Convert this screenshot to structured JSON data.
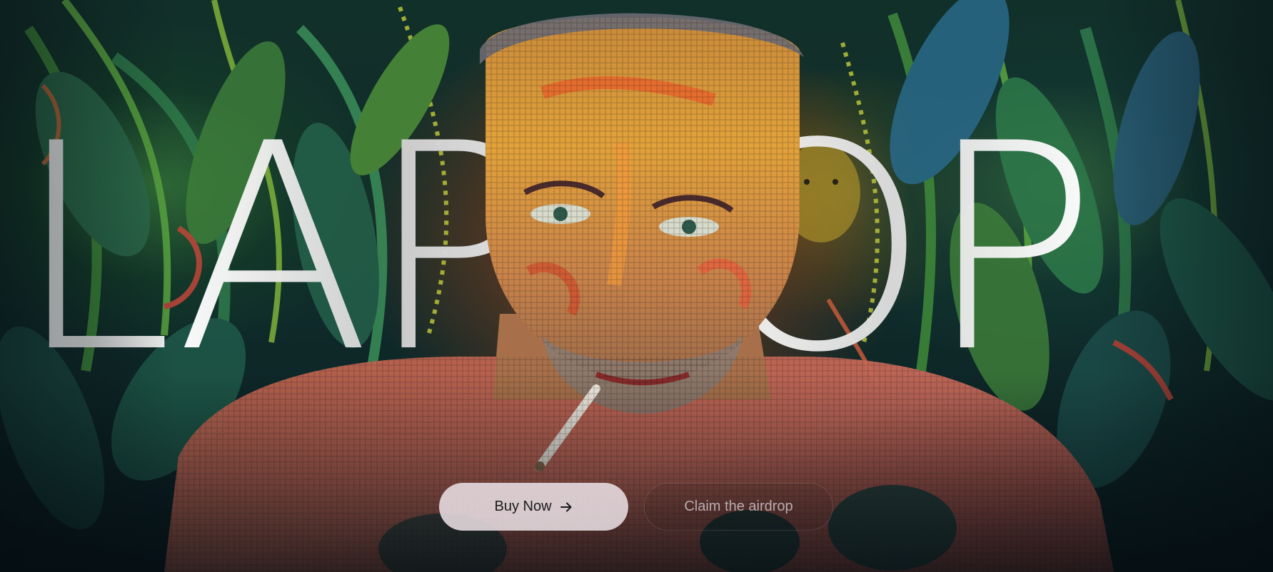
{
  "hero": {
    "title": "LAPTOP",
    "buy_button_label": "Buy Now",
    "airdrop_button_label": "Claim the airdrop"
  },
  "icons": {
    "buy_arrow": "arrow-right-icon"
  },
  "colors": {
    "title": "#f1f1f1",
    "primary_button_bg": "#e8dee2",
    "primary_button_text": "#1b1b1b",
    "secondary_button_text": "#d2c8cd"
  }
}
